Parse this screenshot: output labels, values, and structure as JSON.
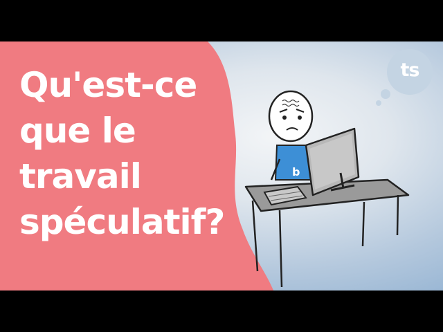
{
  "title": {
    "lines": [
      "Qu'est-ce",
      "que le",
      "travail",
      "spéculatif?"
    ]
  },
  "logo": {
    "text": "ts"
  },
  "shirt_letter": "b",
  "colors": {
    "blob": "#f07b81",
    "background_light": "#f3f5f7",
    "background_dark": "#86aace",
    "shirt": "#3d8fd6",
    "desk": "#9a9a9a",
    "monitor": "#b8b8b8",
    "logo_bubble": "#c4d4e3",
    "text": "#ffffff"
  }
}
